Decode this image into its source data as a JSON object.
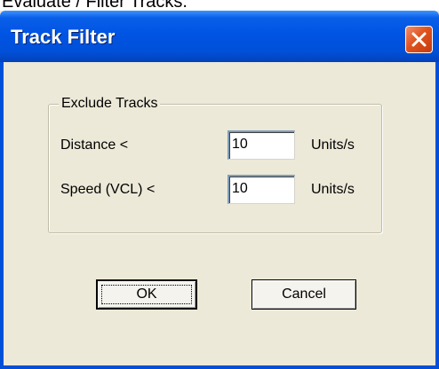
{
  "caption_above": "Evaluate / Filter Tracks.",
  "dialog": {
    "title": "Track Filter",
    "close_icon": "close-x-icon"
  },
  "group": {
    "legend": "Exclude Tracks",
    "rows": [
      {
        "label": "Distance <",
        "value": "10",
        "unit": "Units/s"
      },
      {
        "label": "Speed (VCL) <",
        "value": "10",
        "unit": "Units/s"
      }
    ]
  },
  "buttons": {
    "ok": "OK",
    "cancel": "Cancel"
  },
  "colors": {
    "titlebar": "#0054e3",
    "dialog_bg": "#ece9d8",
    "close_button": "#e0531e"
  }
}
